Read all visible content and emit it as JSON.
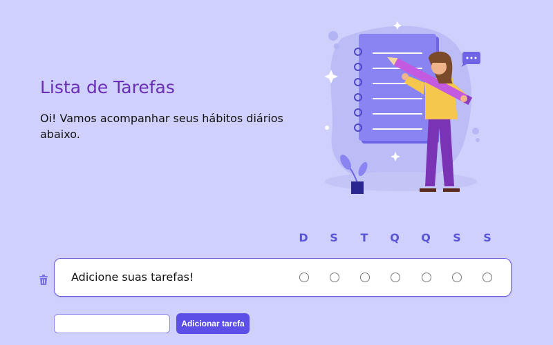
{
  "header": {
    "title": "Lista de Tarefas",
    "subtitle": "Oi! Vamos acompanhar seus hábitos diários abaixo."
  },
  "week_days": [
    "D",
    "S",
    "T",
    "Q",
    "Q",
    "S",
    "S"
  ],
  "tasks": [
    {
      "label": "Adicione suas tarefas!",
      "checks": [
        false,
        false,
        false,
        false,
        false,
        false,
        false
      ]
    }
  ],
  "new_task": {
    "input_value": "",
    "button_label": "Adicionar tarefa"
  },
  "icons": {
    "delete": "trash-icon",
    "illustration": "woman-with-pencil-and-notepad-illustration"
  },
  "colors": {
    "background": "#cfd0fb",
    "title": "#6a2fb6",
    "accent": "#5b4fe8",
    "day_labels": "#5a55d8"
  }
}
